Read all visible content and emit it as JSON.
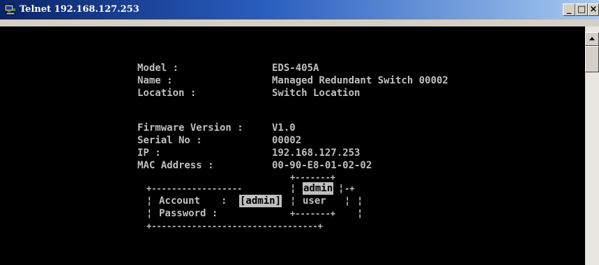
{
  "window": {
    "title": "Telnet 192.168.127.253",
    "app_icon": "telnet-terminal-icon",
    "buttons": {
      "minimize": "_",
      "maximize": "□",
      "close": "×"
    }
  },
  "info": {
    "model_label": "Model :",
    "model_value": "EDS-405A",
    "name_label": "Name :",
    "name_value": "Managed Redundant Switch 00002",
    "location_label": "Location :",
    "location_value": "Switch Location",
    "firmware_label": "Firmware Version :",
    "firmware_value": "V1.0",
    "serial_label": "Serial No :",
    "serial_value": "00002",
    "ip_label": "IP :",
    "ip_value": "192.168.127.253",
    "mac_label": "MAC Address :",
    "mac_value": "00-90-E8-01-02-02"
  },
  "login": {
    "account_label": "Account",
    "account_value": "[admin]",
    "password_label": "Password :",
    "options": [
      "admin",
      "user"
    ],
    "selected_option": "admin"
  },
  "borders": {
    "dropdown_top": "+-------+",
    "box_top_left": "+------------------",
    "box_top_right": "-+",
    "dropdown_bottom": "+-------+",
    "box_bottom": "+---------------------------------+"
  },
  "colors": {
    "terminal_bg": "#000000",
    "terminal_text": "#c0c0c0",
    "highlight_bg": "#c0c0c0",
    "highlight_text": "#000000",
    "titlebar_start": "#0a246a",
    "titlebar_end": "#a6caf0"
  }
}
